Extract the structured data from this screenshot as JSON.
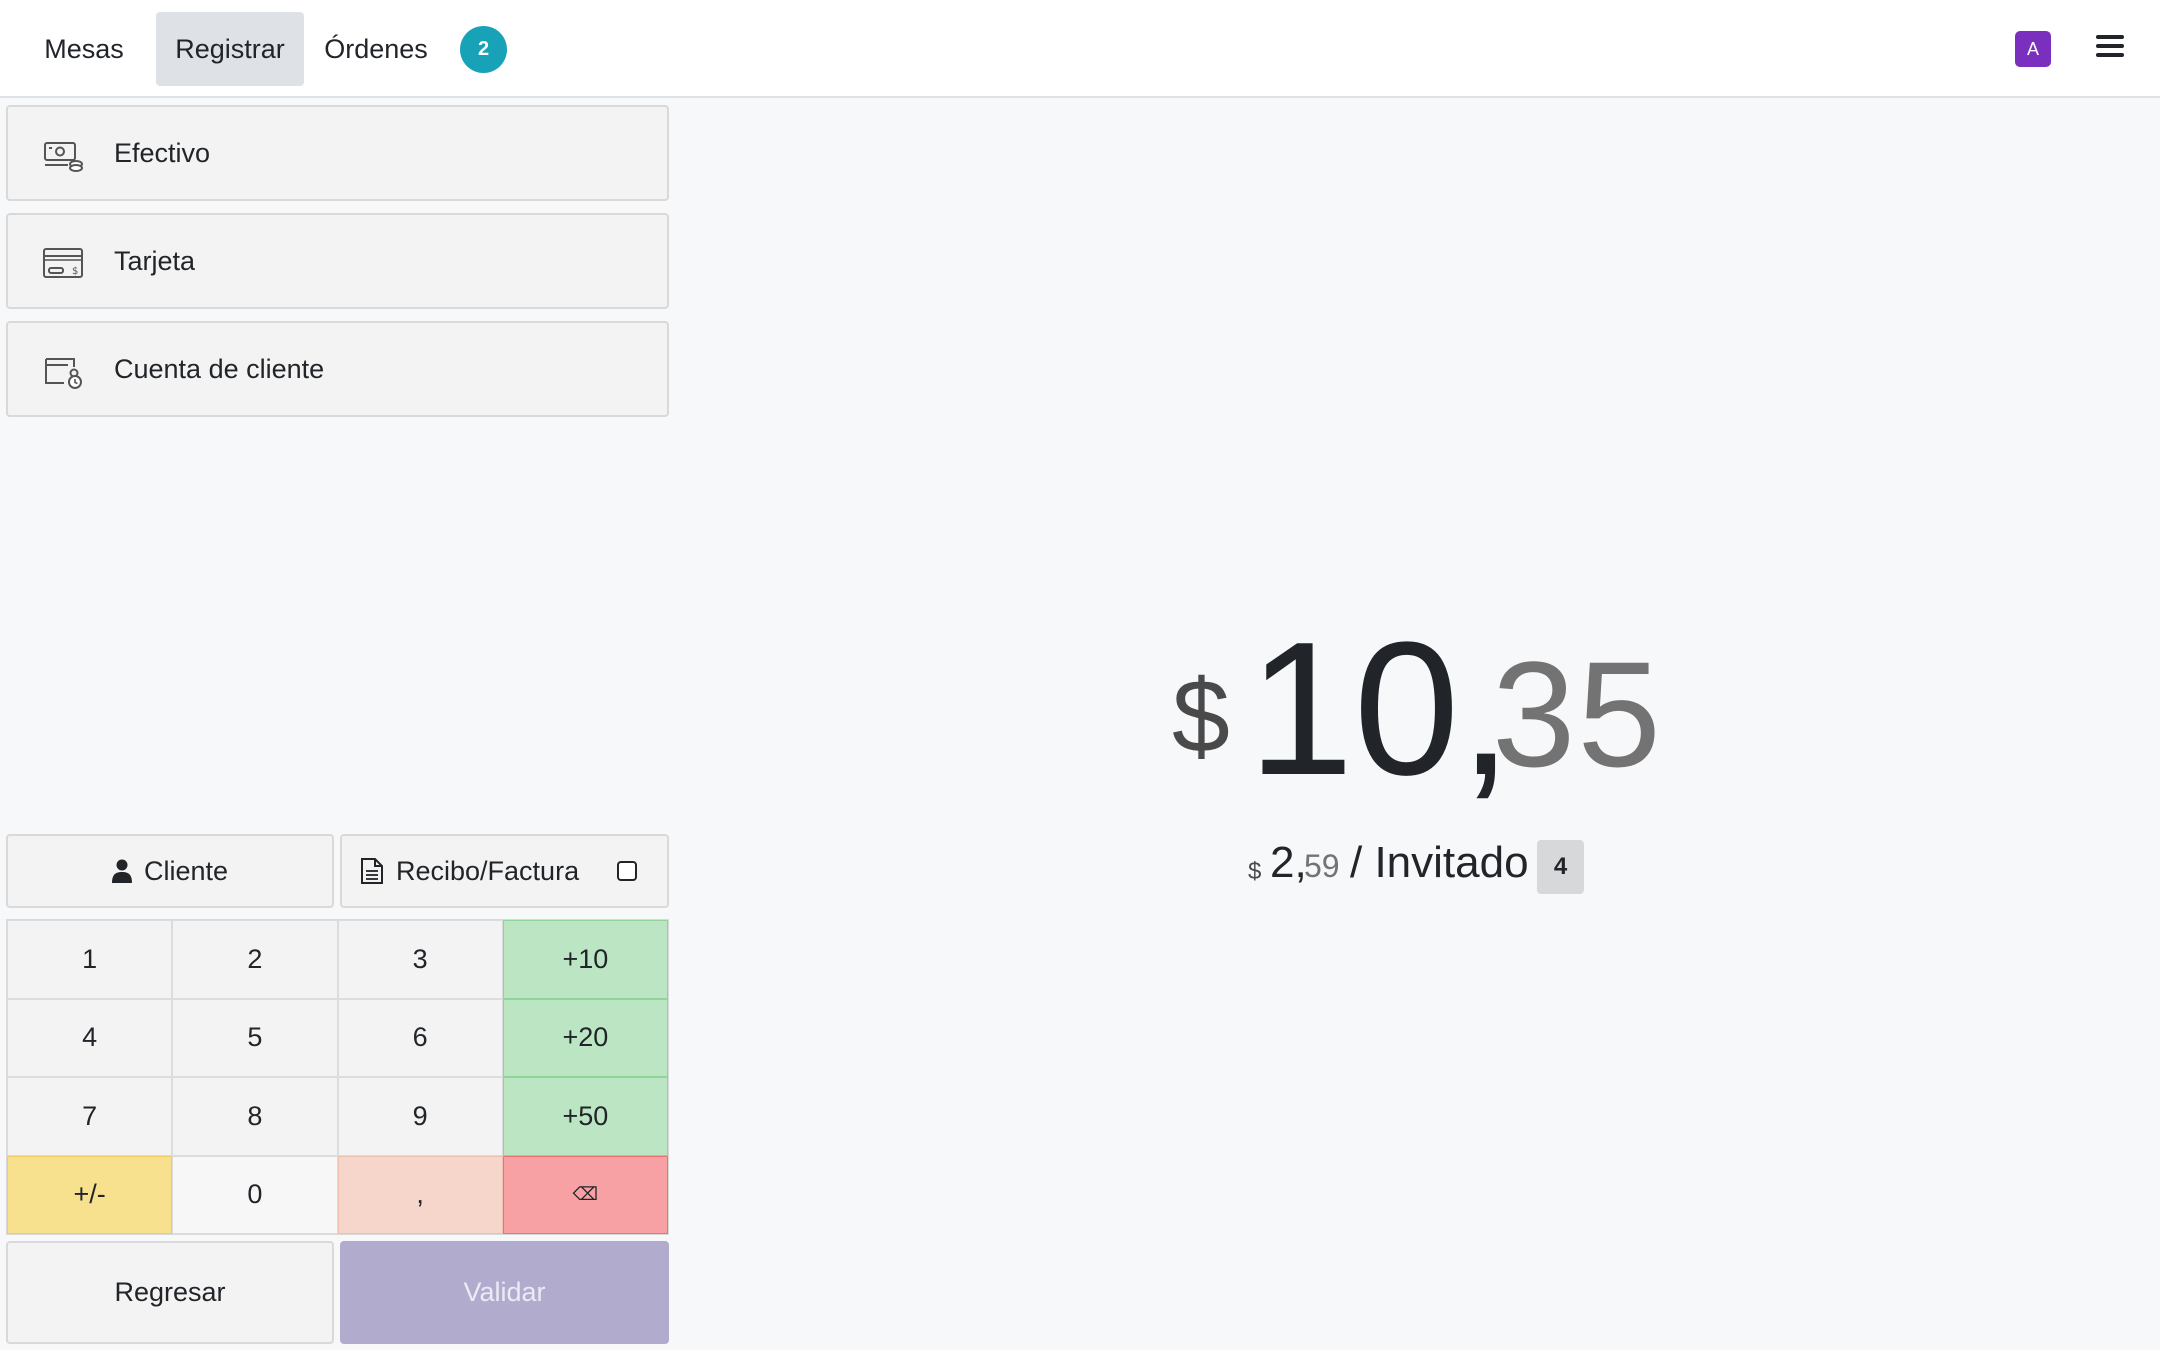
{
  "navbar": {
    "tabs": [
      {
        "label": "Mesas",
        "active": false
      },
      {
        "label": "Registrar",
        "active": true
      },
      {
        "label": "Órdenes",
        "active": false
      }
    ],
    "orders_badge": "2",
    "avatar_initial": "A",
    "menu_icon": "hamburger-icon"
  },
  "payment_methods": [
    {
      "label": "Efectivo",
      "icon": "cash-icon"
    },
    {
      "label": "Tarjeta",
      "icon": "credit-card-icon"
    },
    {
      "label": "Cuenta de cliente",
      "icon": "customer-account-icon"
    }
  ],
  "controls": {
    "customer_label": "Cliente",
    "invoice_label": "Recibo/Factura",
    "invoice_checked": false
  },
  "numpad": {
    "keys": [
      "1",
      "2",
      "3",
      "+10",
      "4",
      "5",
      "6",
      "+20",
      "7",
      "8",
      "9",
      "+50",
      "+/-",
      "0",
      ",",
      "⌫"
    ]
  },
  "actions": {
    "back_label": "Regresar",
    "validate_label": "Validar"
  },
  "total": {
    "currency": "$",
    "integer": "10,",
    "decimals": "35"
  },
  "per_guest": {
    "currency": "$",
    "integer": "2,",
    "decimals": "59",
    "label": "/ Invitado",
    "guests": "4"
  },
  "colors": {
    "accent_badge": "#17a2b8",
    "avatar": "#7b2fbf",
    "validate": "#b1acce",
    "quick_add": "#bce6c3",
    "sign_toggle": "#f7e08e",
    "decimal": "#f6d5ca",
    "backspace": "#f7a1a4"
  }
}
